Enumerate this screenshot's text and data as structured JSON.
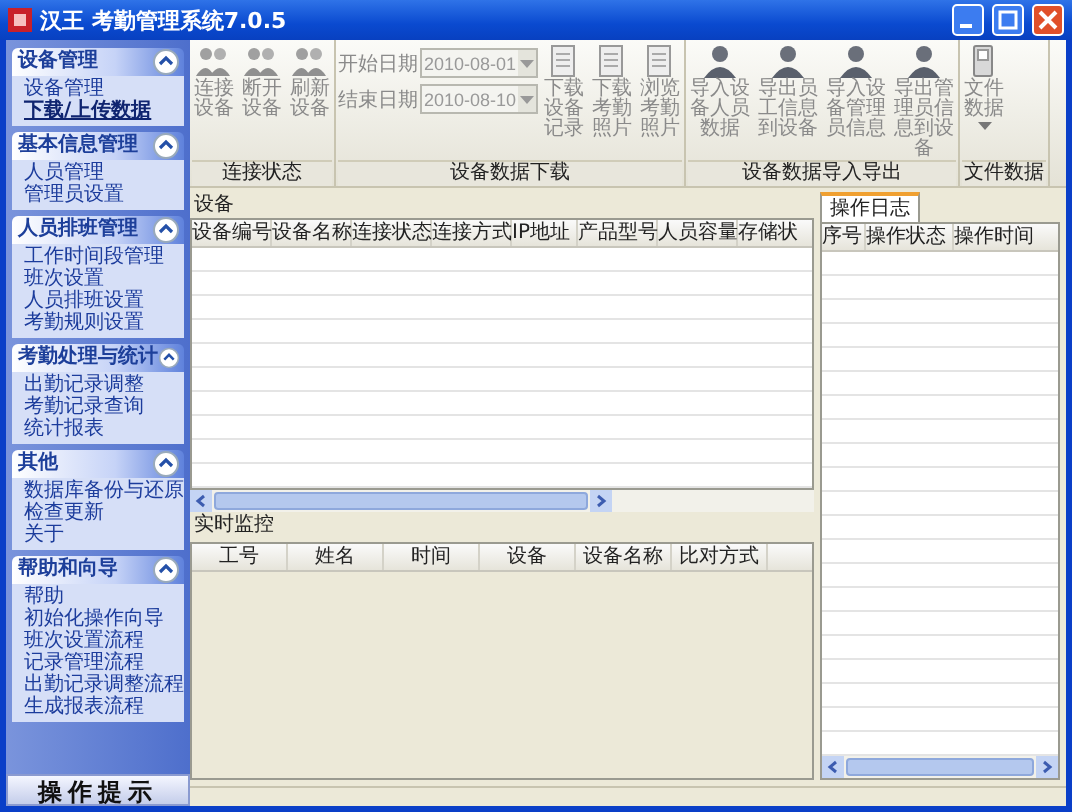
{
  "window": {
    "title": "汉王 考勤管理系统7.0.5"
  },
  "sidebar": {
    "sections": [
      {
        "title": "设备管理",
        "expanded": true,
        "items": [
          {
            "label": "设备管理",
            "selected": false
          },
          {
            "label": "下载/上传数据",
            "selected": true
          }
        ]
      },
      {
        "title": "基本信息管理",
        "expanded": true,
        "items": [
          {
            "label": "人员管理",
            "selected": false
          },
          {
            "label": "管理员设置",
            "selected": false
          }
        ]
      },
      {
        "title": "人员排班管理",
        "expanded": true,
        "items": [
          {
            "label": "工作时间段管理",
            "selected": false
          },
          {
            "label": "班次设置",
            "selected": false
          },
          {
            "label": "人员排班设置",
            "selected": false
          },
          {
            "label": "考勤规则设置",
            "selected": false
          }
        ]
      },
      {
        "title": "考勤处理与统计",
        "expanded": true,
        "items": [
          {
            "label": "出勤记录调整",
            "selected": false
          },
          {
            "label": "考勤记录查询",
            "selected": false
          },
          {
            "label": "统计报表",
            "selected": false
          }
        ]
      },
      {
        "title": "其他",
        "expanded": true,
        "items": [
          {
            "label": "数据库备份与还原",
            "selected": false
          },
          {
            "label": "检查更新",
            "selected": false
          },
          {
            "label": "关于",
            "selected": false
          }
        ]
      },
      {
        "title": "帮助和向导",
        "expanded": true,
        "items": [
          {
            "label": "帮助",
            "selected": false
          },
          {
            "label": "初始化操作向导",
            "selected": false
          },
          {
            "label": "班次设置流程",
            "selected": false
          },
          {
            "label": "记录管理流程",
            "selected": false
          },
          {
            "label": "出勤记录调整流程",
            "selected": false
          },
          {
            "label": "生成报表流程",
            "selected": false
          }
        ]
      }
    ],
    "footer_button": "操作提示"
  },
  "toolbar": {
    "groups": [
      {
        "label": "连接状态",
        "items": [
          {
            "kind": "connect",
            "label": "连接设备"
          },
          {
            "kind": "connect",
            "label": "断开设备"
          },
          {
            "kind": "connect",
            "label": "刷新设备"
          }
        ]
      },
      {
        "label": "设备数据下载",
        "items": [
          {
            "kind": "date",
            "label": "开始日期",
            "value": "2010-08-01"
          },
          {
            "kind": "date",
            "label": "结束日期",
            "value": "2010-08-10"
          },
          {
            "kind": "download",
            "label": "下载设备记录"
          },
          {
            "kind": "download",
            "label": "下载考勤照片"
          },
          {
            "kind": "download",
            "label": "浏览考勤照片"
          }
        ]
      },
      {
        "label": "设备数据导入导出",
        "items": [
          {
            "kind": "transfer",
            "label": "导入设备人员数据"
          },
          {
            "kind": "transfer",
            "label": "导出员工信息到设备"
          },
          {
            "kind": "transfer",
            "label": "导入设备管理员信息"
          },
          {
            "kind": "transfer",
            "label": "导出管理员信息到设备"
          }
        ]
      },
      {
        "label": "文件数据",
        "items": [
          {
            "kind": "file",
            "label": "文件数据"
          }
        ]
      }
    ]
  },
  "devices": {
    "title": "设备",
    "columns": [
      "设备编号",
      "设备名称",
      "连接状态",
      "连接方式",
      "IP地址",
      "产品型号",
      "人员容量",
      "存储状"
    ]
  },
  "monitor": {
    "title": "实时监控",
    "columns": [
      "工号",
      "姓名",
      "时间",
      "设备",
      "设备名称",
      "比对方式"
    ]
  },
  "log": {
    "tabs": [
      {
        "label": "操作日志",
        "selected": true
      }
    ],
    "columns": [
      "序号",
      "操作状态",
      "操作时间"
    ]
  }
}
